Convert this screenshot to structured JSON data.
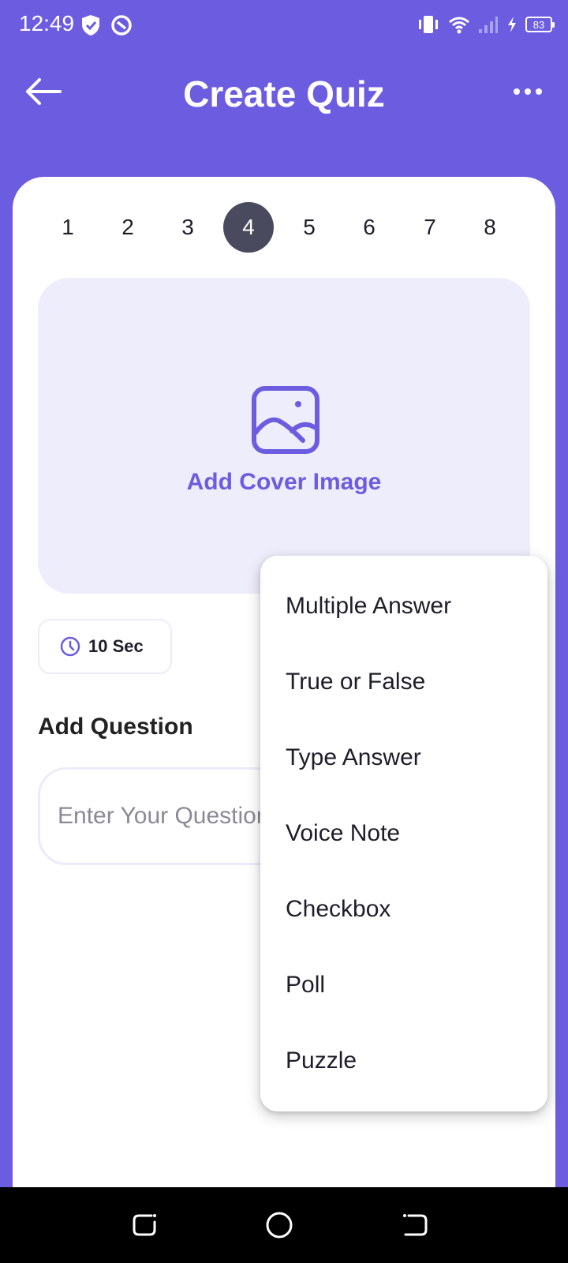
{
  "status_bar": {
    "time": "12:49",
    "battery": "83"
  },
  "header": {
    "title": "Create Quiz"
  },
  "question_numbers": [
    "1",
    "2",
    "3",
    "4",
    "5",
    "6",
    "7",
    "8"
  ],
  "active_question": "4",
  "cover": {
    "label": "Add Cover Image"
  },
  "timer": {
    "label": "10 Sec"
  },
  "question": {
    "heading": "Add Question",
    "placeholder": "Enter Your Question"
  },
  "menu": {
    "items": [
      "Multiple Answer",
      "True or False",
      "Type Answer",
      "Voice Note",
      "Checkbox",
      "Poll",
      "Puzzle"
    ]
  },
  "colors": {
    "accent": "#6C5CE0",
    "active_number": "#4a4a5e",
    "cover_bg": "#EEEDFB"
  }
}
